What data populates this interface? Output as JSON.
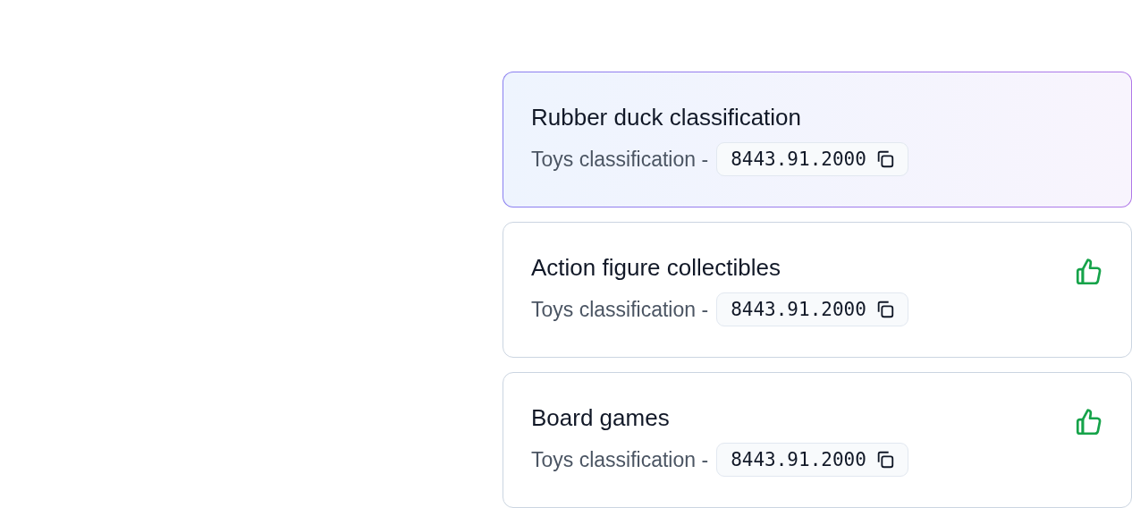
{
  "results": [
    {
      "title": "Rubber duck classification",
      "category": "Toys classification -",
      "code": "8443.91.2000",
      "selected": true,
      "liked": false
    },
    {
      "title": "Action figure collectibles",
      "category": "Toys classification -",
      "code": "8443.91.2000",
      "selected": false,
      "liked": true
    },
    {
      "title": "Board games",
      "category": "Toys classification -",
      "code": "8443.91.2000",
      "selected": false,
      "liked": true
    }
  ]
}
